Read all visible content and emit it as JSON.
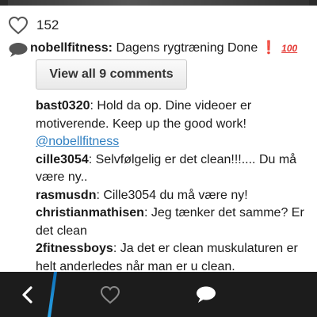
{
  "post": {
    "like_count": "152",
    "caption": {
      "username": "nobellfitness:",
      "text": " Dagens rygtræning Done",
      "emoji_exclamation": "❗",
      "emoji_hundred": "100"
    },
    "view_all_label": "View all 9 comments"
  },
  "comments": [
    {
      "user": "bast0320",
      "text": ": Hold da op. Dine videoer er motiverende. Keep up the good work!",
      "mention": "@nobellfitness"
    },
    {
      "user": "cille3054",
      "text": ": Selvfølgelig er det clean!!!.... Du må være ny.."
    },
    {
      "user": "rasmusdn",
      "text": ": Cille3054 du må være ny!"
    },
    {
      "user": "christianmathisen",
      "text": ": Jeg tænker det samme? Er det clean"
    },
    {
      "user": "2fitnessboys",
      "text": ": Ja det er clean muskulaturen er helt anderledes når man er u clean."
    }
  ],
  "nav": {
    "back_icon": "chevron-left-icon",
    "like_icon": "heart-outline-icon",
    "comment_icon": "speech-bubble-icon"
  },
  "colors": {
    "nav_background": "#1c1c1c",
    "accent_blue": "#2aa3e6",
    "mention_blue": "#2f7fc1",
    "emoji_red": "#e53935"
  }
}
